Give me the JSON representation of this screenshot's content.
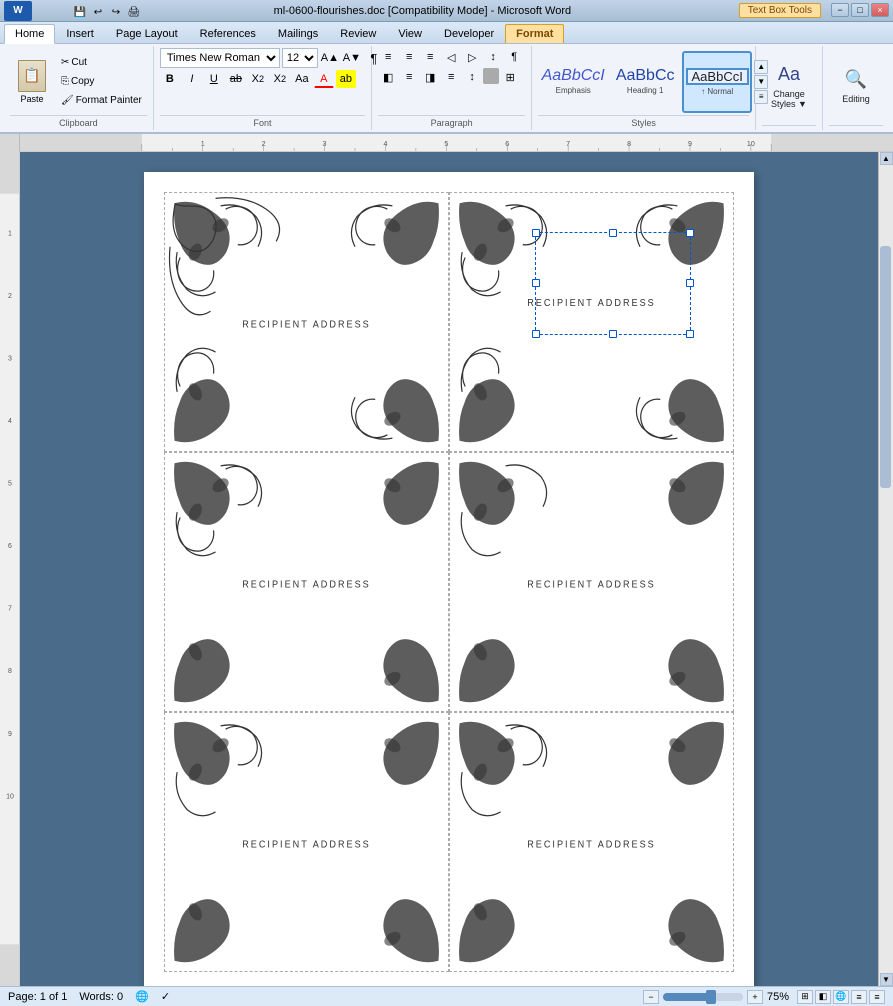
{
  "titlebar": {
    "title": "ml-0600-flourishes.doc [Compatibility Mode] - Microsoft Word",
    "context_tab": "Text Box Tools",
    "minimize": "−",
    "maximize": "□",
    "close": "×"
  },
  "tabs": [
    {
      "label": "Home",
      "active": true
    },
    {
      "label": "Insert",
      "active": false
    },
    {
      "label": "Page Layout",
      "active": false
    },
    {
      "label": "References",
      "active": false
    },
    {
      "label": "Mailings",
      "active": false
    },
    {
      "label": "Review",
      "active": false
    },
    {
      "label": "View",
      "active": false
    },
    {
      "label": "Developer",
      "active": false
    },
    {
      "label": "Format",
      "active": false,
      "context": true
    }
  ],
  "ribbon": {
    "clipboard": {
      "label": "Clipboard",
      "paste_label": "Paste",
      "cut_label": "Cut",
      "copy_label": "Copy",
      "format_painter_label": "Format Painter"
    },
    "font": {
      "label": "Font",
      "font_name": "Times New Roman",
      "font_size": "12",
      "bold": "B",
      "italic": "I",
      "underline": "U",
      "strikethrough": "ab",
      "subscript": "X₂",
      "superscript": "X²",
      "change_case": "Aa",
      "font_color": "A",
      "highlight": "▲"
    },
    "paragraph": {
      "label": "Paragraph",
      "bullets": "≡",
      "numbering": "≡",
      "multilevel": "≡",
      "dec_indent": "◁",
      "inc_indent": "▷",
      "sort": "↕",
      "show_marks": "¶",
      "align_left": "≡",
      "align_center": "≡",
      "align_right": "≡",
      "justify": "≡",
      "line_spacing": "↕",
      "shading": "□",
      "borders": "□"
    },
    "styles": {
      "label": "Styles",
      "emphasis_label": "Emphasis",
      "heading1_label": "Heading 1",
      "normal_label": "↑ Normal",
      "change_styles_label": "Change\nStyles",
      "editing_label": "Editing"
    }
  },
  "document": {
    "labels": [
      {
        "text": "RECIPIENT ADDRESS",
        "row": 0,
        "col": 0,
        "selected": false
      },
      {
        "text": "RECIPIENT ADDRESS",
        "row": 0,
        "col": 1,
        "selected": true
      },
      {
        "text": "RECIPIENT ADDRESS",
        "row": 1,
        "col": 0,
        "selected": false
      },
      {
        "text": "RECIPIENT ADDRESS",
        "row": 1,
        "col": 1,
        "selected": false
      },
      {
        "text": "RECIPIENT ADDRESS",
        "row": 2,
        "col": 0,
        "selected": false
      },
      {
        "text": "RECIPIENT ADDRESS",
        "row": 2,
        "col": 1,
        "selected": false
      }
    ]
  },
  "statusbar": {
    "page": "Page: 1 of 1",
    "words": "Words: 0",
    "zoom_level": "75%",
    "zoom_percent": 75
  }
}
